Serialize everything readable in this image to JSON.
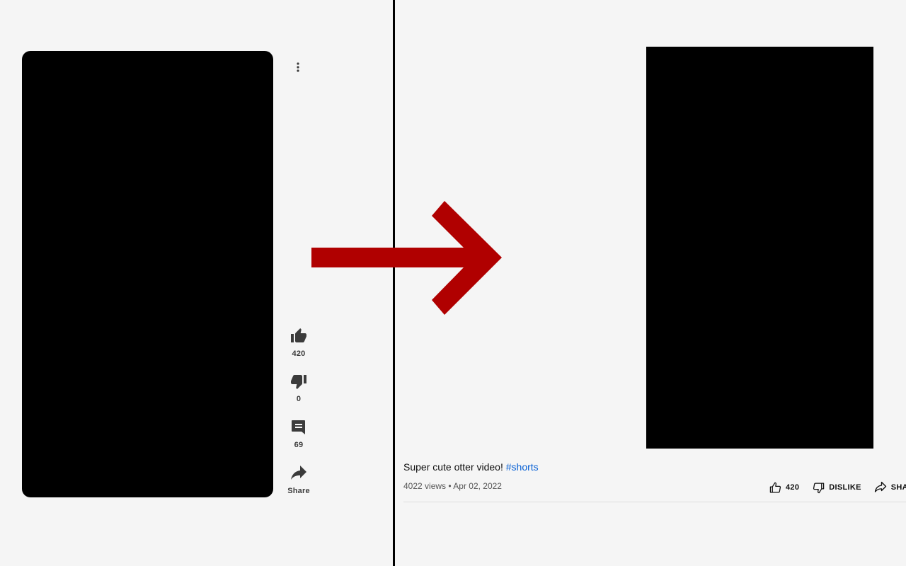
{
  "shorts": {
    "like_count": "420",
    "dislike_count": "0",
    "comment_count": "69",
    "share_label": "Share"
  },
  "watch": {
    "title_text": "Super cute otter video! ",
    "hashtag": "#shorts",
    "views": "4022 views",
    "separator": "•",
    "date": "Apr 02, 2022",
    "like_count": "420",
    "dislike_label": "DISLIKE",
    "share_label": "SHARE"
  },
  "colors": {
    "arrow": "#b00000",
    "hashtag": "#065fd4",
    "divider": "#000000",
    "player": "#000000"
  },
  "icons": {
    "more": "more-vert-icon",
    "like": "thumb-up-icon",
    "dislike": "thumb-down-icon",
    "comment": "comment-icon",
    "share": "share-icon"
  }
}
